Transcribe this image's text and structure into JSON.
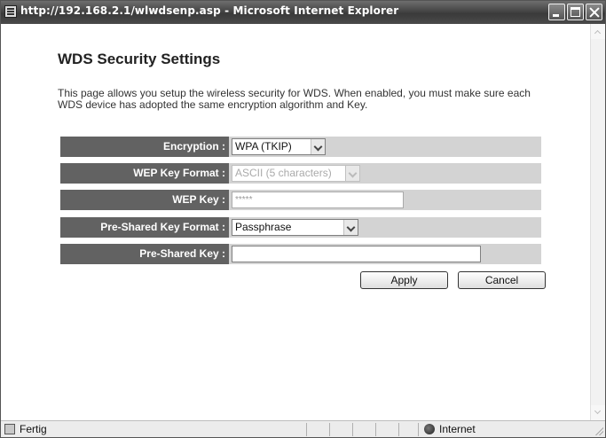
{
  "window": {
    "title": "http://192.168.2.1/wlwdsenp.asp - Microsoft Internet Explorer"
  },
  "page": {
    "heading": "WDS Security Settings",
    "description": "This page allows you setup the wireless security for WDS. When enabled, you must make sure each WDS device has adopted the same encryption algorithm and Key."
  },
  "form": {
    "encryption": {
      "label": "Encryption :",
      "value": "WPA (TKIP)"
    },
    "wep_key_format": {
      "label": "WEP Key Format :",
      "value": "ASCII (5 characters)"
    },
    "wep_key": {
      "label": "WEP Key :",
      "value": "*****"
    },
    "psk_format": {
      "label": "Pre-Shared Key Format :",
      "value": "Passphrase"
    },
    "psk": {
      "label": "Pre-Shared Key :",
      "value": ""
    }
  },
  "buttons": {
    "apply": "Apply",
    "cancel": "Cancel"
  },
  "statusbar": {
    "status": "Fertig",
    "zone": "Internet"
  },
  "icons": {
    "title": "ie-page-icon",
    "status": "ie-page-icon",
    "zone": "globe-icon"
  }
}
